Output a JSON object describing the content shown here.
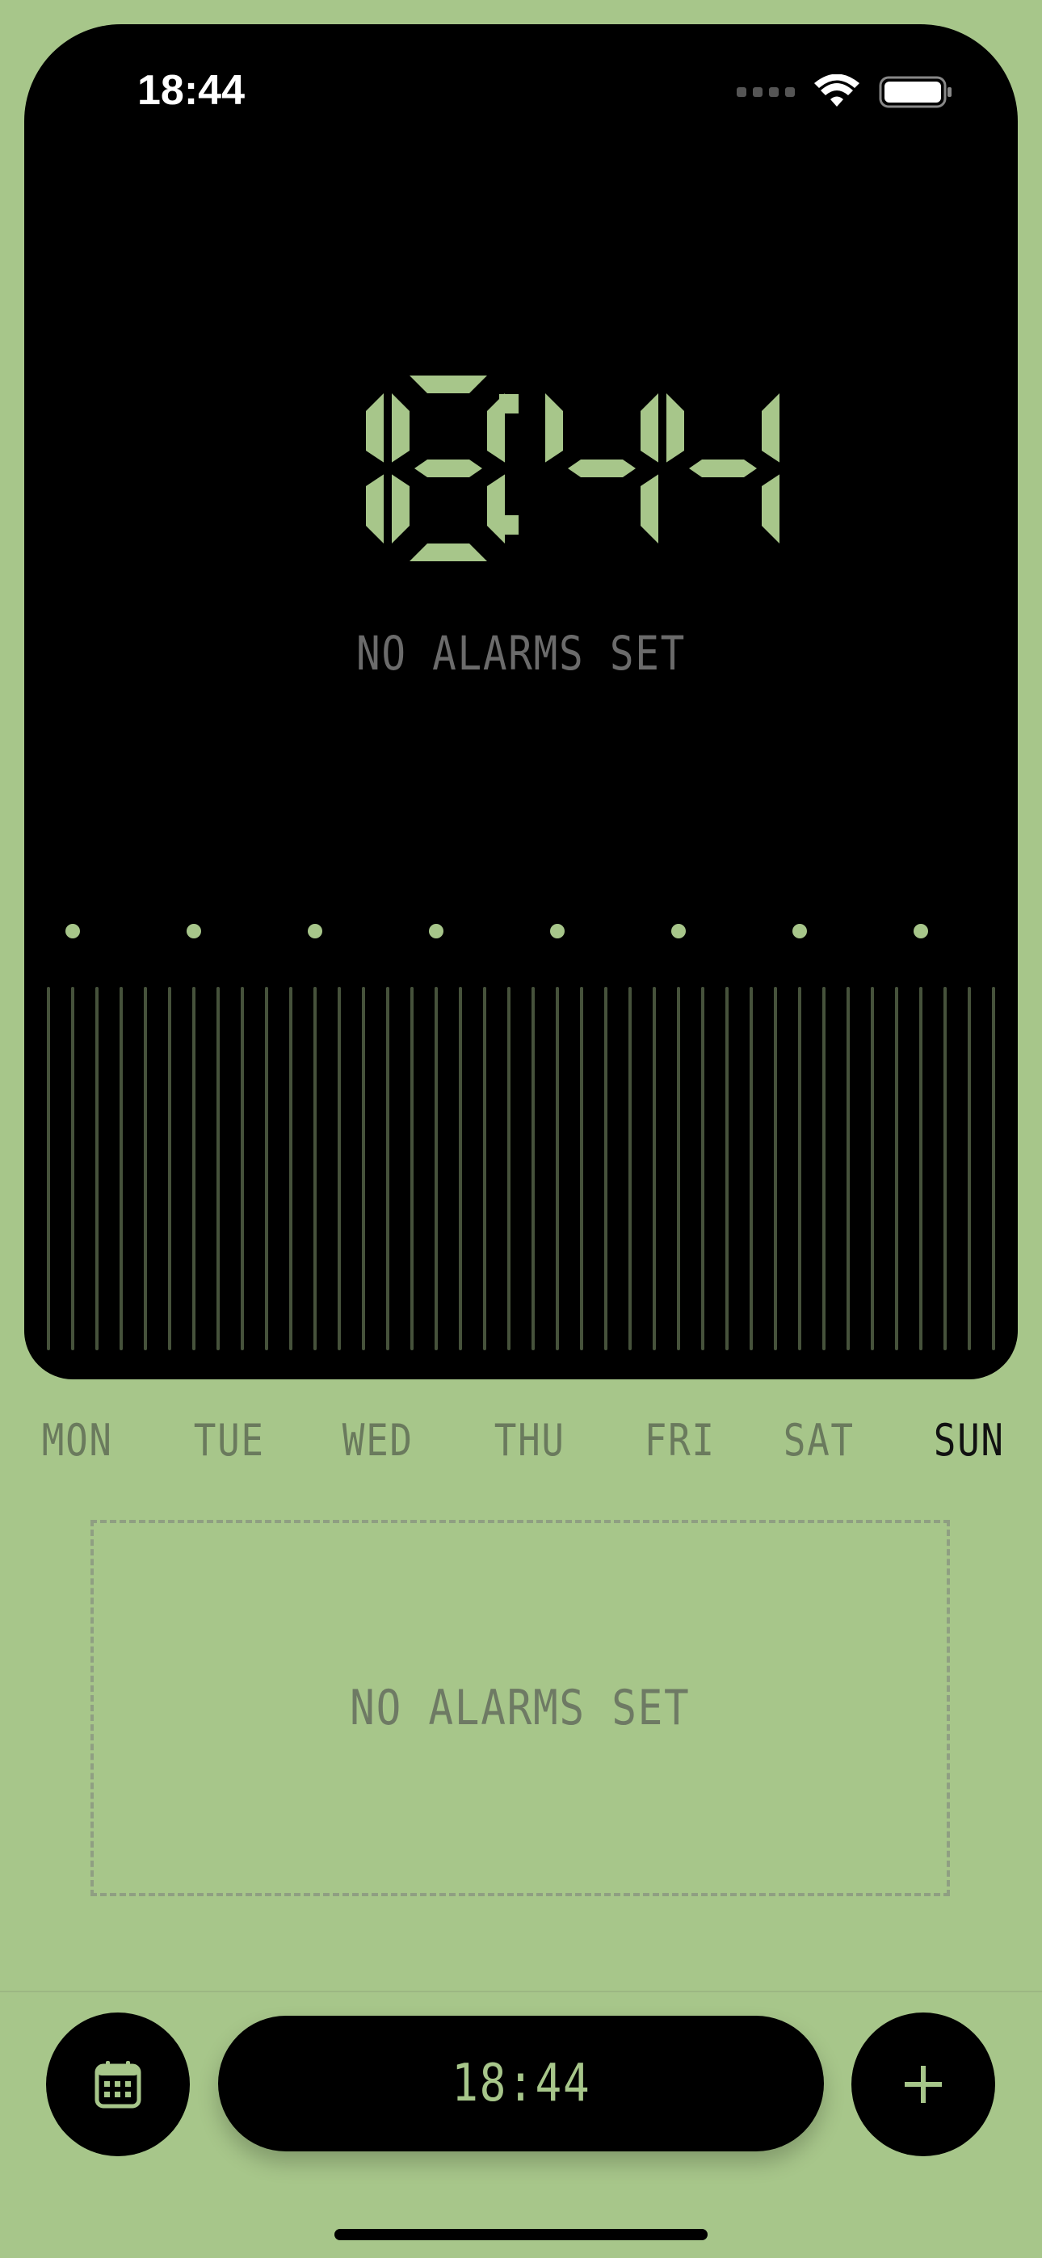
{
  "status_bar": {
    "time": "18:44"
  },
  "clock": {
    "time": "18:44",
    "alarm_status": "NO ALARMS SET"
  },
  "days": [
    {
      "label": "MON",
      "active": false
    },
    {
      "label": "TUE",
      "active": false
    },
    {
      "label": "WED",
      "active": false
    },
    {
      "label": "THU",
      "active": false
    },
    {
      "label": "FRI",
      "active": false
    },
    {
      "label": "SAT",
      "active": false
    },
    {
      "label": "SUN",
      "active": true
    }
  ],
  "alarm_list": {
    "empty_label": "NO ALARMS SET"
  },
  "toolbar": {
    "calendar_icon": "calendar-icon",
    "time_display": "18:44",
    "add_icon": "plus-icon"
  },
  "colors": {
    "background": "#a7c68a",
    "screen": "#000000",
    "accent": "#a7c68a"
  }
}
